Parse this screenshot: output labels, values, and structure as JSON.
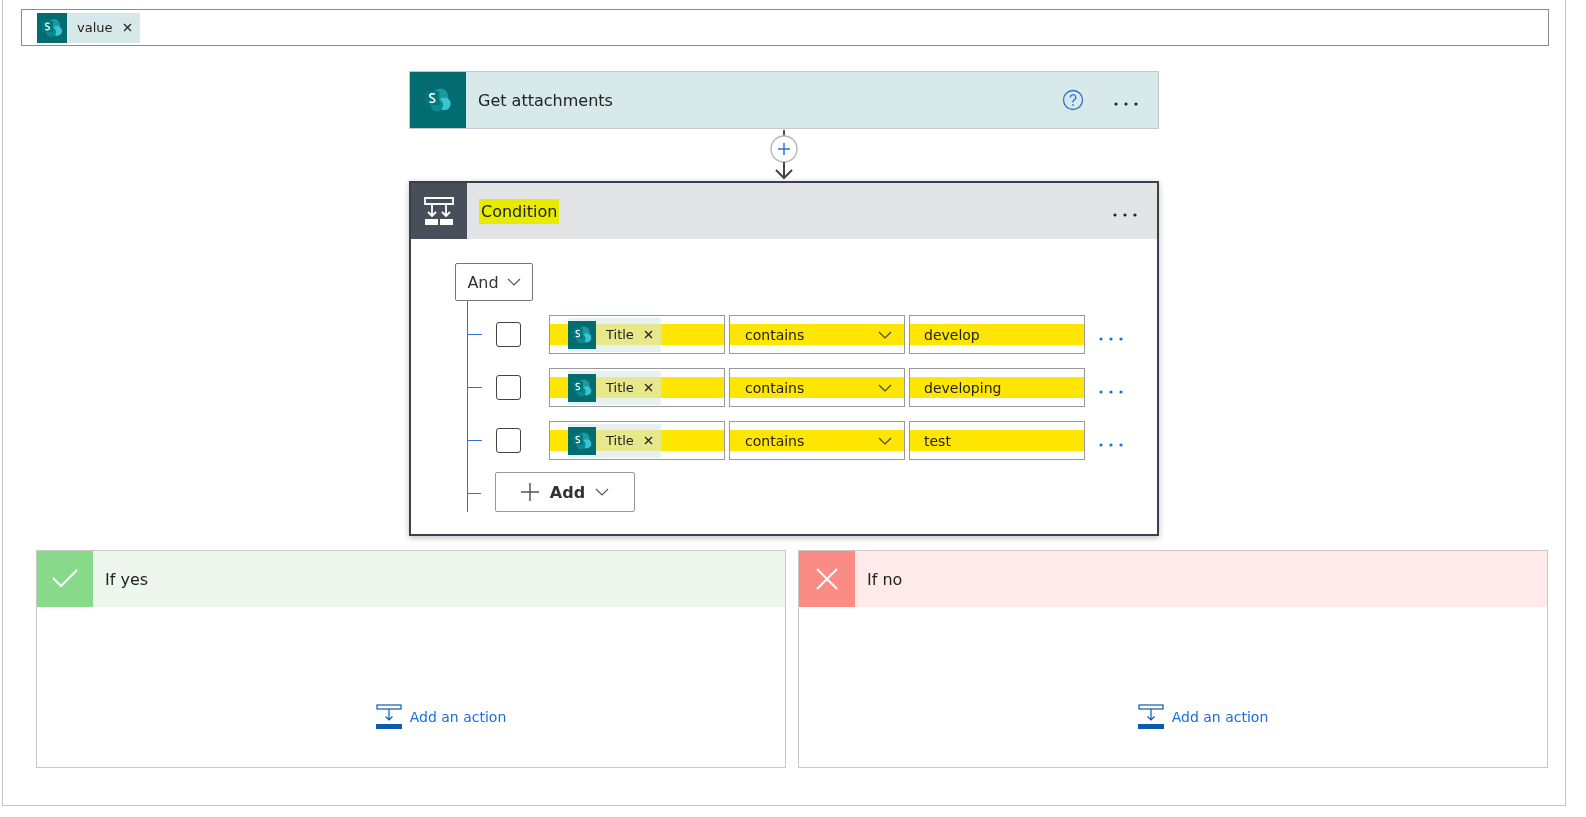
{
  "output_field": {
    "token": "value"
  },
  "action": {
    "title": "Get attachments"
  },
  "condition": {
    "title": "Condition",
    "title_highlighted": true,
    "group_operator": "And",
    "rows": [
      {
        "token": "Title",
        "operator": "contains",
        "value": "develop",
        "checked": false,
        "highlighted": true
      },
      {
        "token": "Title",
        "operator": "contains",
        "value": "developing",
        "checked": false,
        "highlighted": true
      },
      {
        "token": "Title",
        "operator": "contains",
        "value": "test",
        "checked": false,
        "highlighted": true
      }
    ],
    "add_button": "Add"
  },
  "branches": [
    {
      "kind": "yes",
      "title": "If yes",
      "add_action": "Add an action"
    },
    {
      "kind": "no",
      "title": "If no",
      "add_action": "Add an action"
    }
  ]
}
